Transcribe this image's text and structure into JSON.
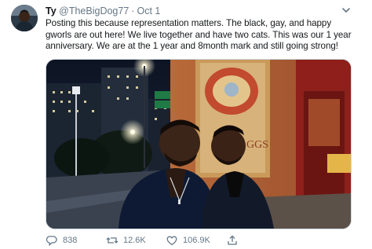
{
  "tweet": {
    "display_name": "Ty",
    "handle": "@TheBigDog77",
    "separator": "·",
    "date": "Oct 1",
    "text": "Posting this because representation matters. The black, gay, and happy gworls are out here! We live together and have two cats. This was our 1 year anniversary. We are at the 1 year and 8month mark and still going strong!",
    "media_description": "photo",
    "actions": {
      "reply_count": "838",
      "retweet_count": "12.6K",
      "like_count": "106.9K"
    }
  },
  "icons": {
    "menu": "chevron-down-icon",
    "reply": "reply-icon",
    "retweet": "retweet-icon",
    "like": "heart-icon",
    "share": "share-icon"
  },
  "colors": {
    "text_primary": "#14171a",
    "text_secondary": "#657786",
    "border": "#ccd6dd"
  }
}
